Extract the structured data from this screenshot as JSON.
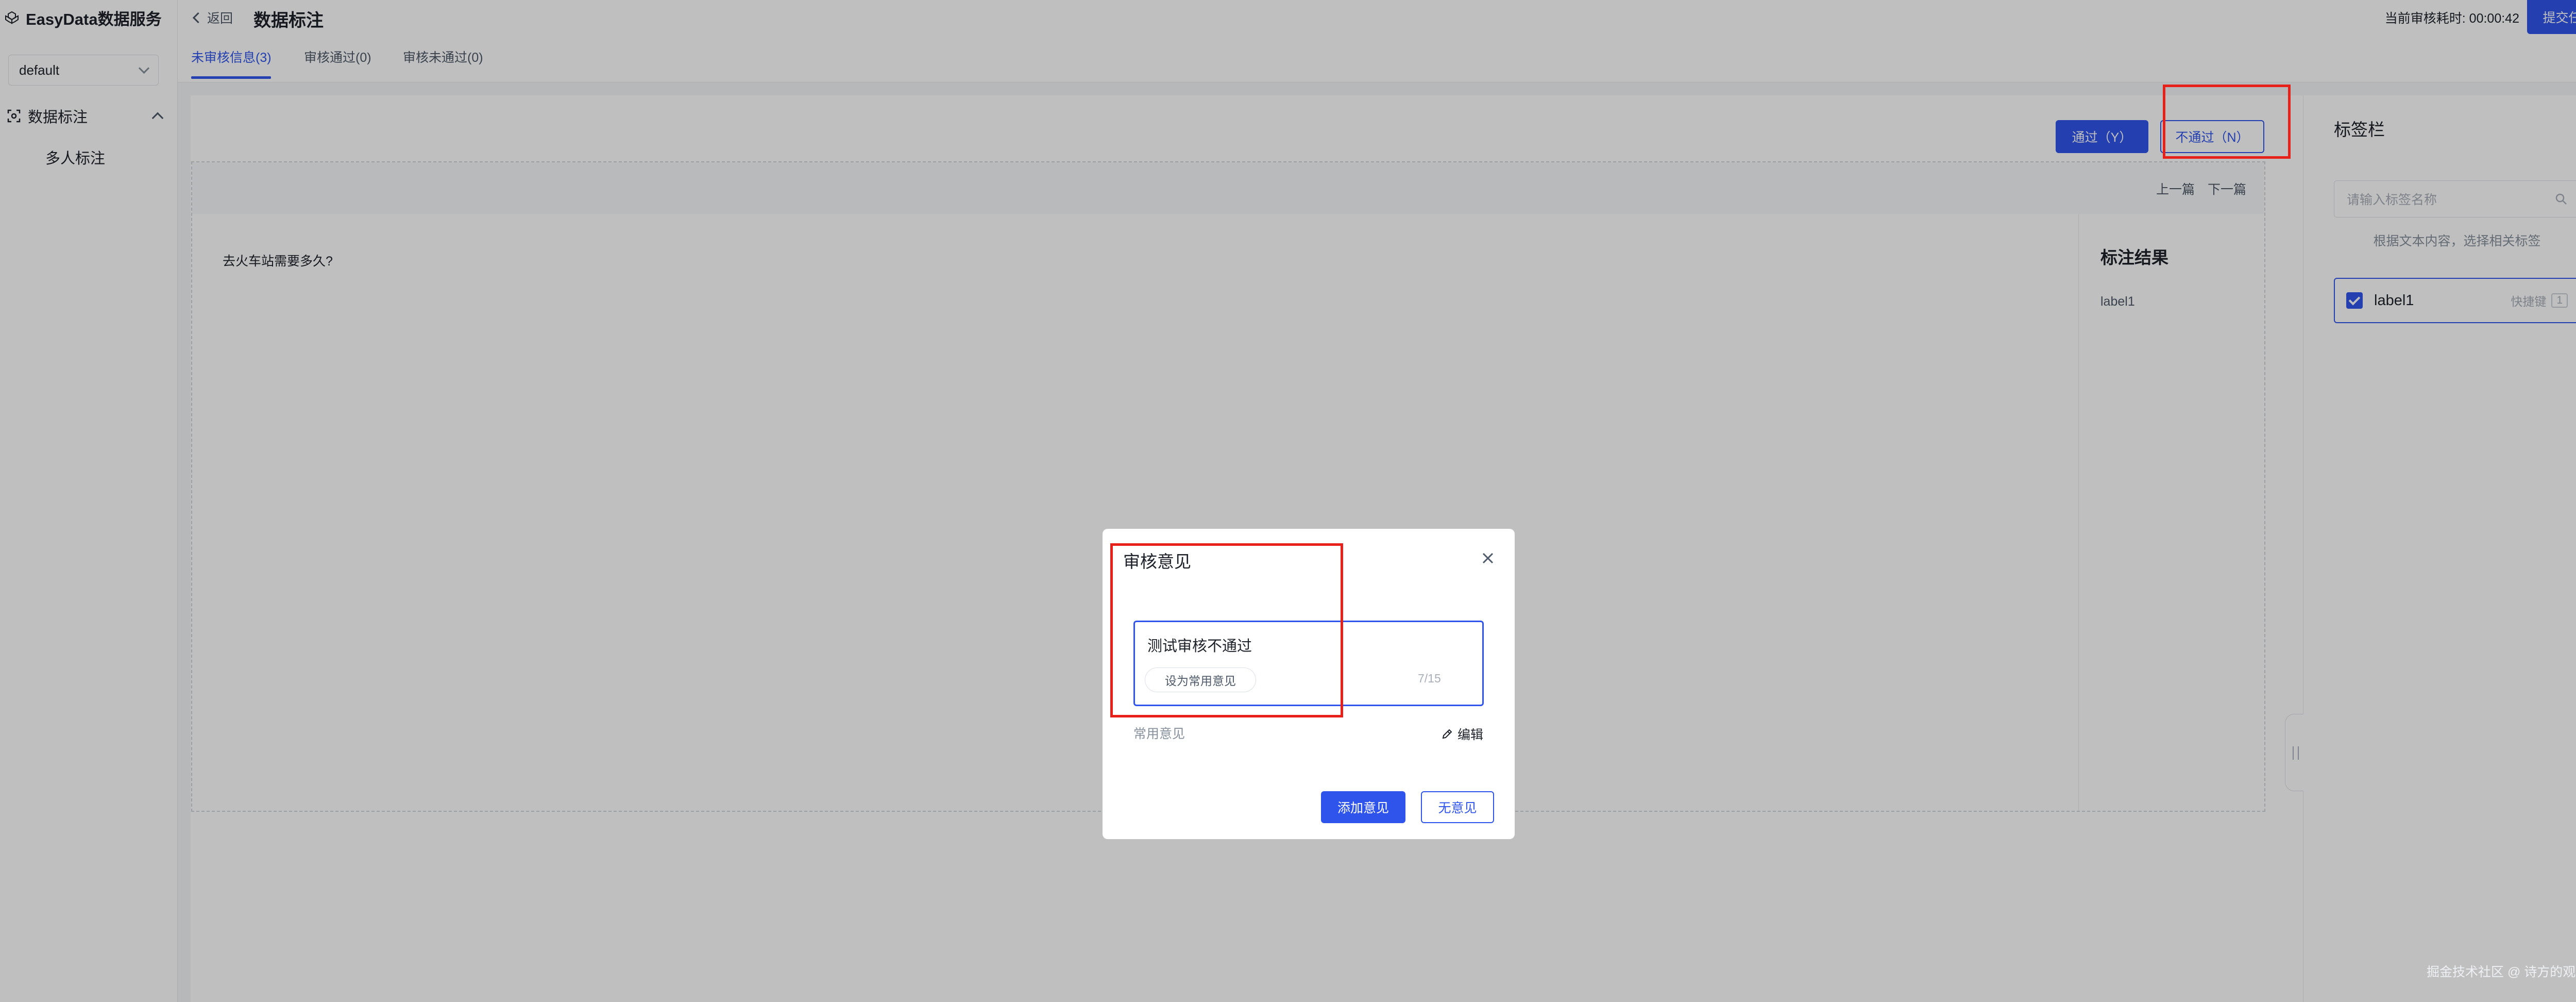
{
  "app": {
    "name": "EasyData数据服务"
  },
  "sidebar": {
    "workspace": "default",
    "group_label": "数据标注",
    "sub_item": "多人标注"
  },
  "header": {
    "back_label": "返回",
    "title": "数据标注",
    "timer": "当前审核耗时: 00:00:42",
    "submit_label": "提交任务",
    "tabs": [
      {
        "label": "未审核信息(3)",
        "active": true
      },
      {
        "label": "审核通过(0)",
        "active": false
      },
      {
        "label": "审核未通过(0)",
        "active": false
      }
    ]
  },
  "toolbar": {
    "pass_label": "通过（Y）",
    "reject_label": "不通过（N）"
  },
  "pager": {
    "prev_label": "上一篇",
    "next_label": "下一篇"
  },
  "content": {
    "text": "去火车站需要多久?"
  },
  "result": {
    "title": "标注结果",
    "label": "label1"
  },
  "tagbar": {
    "title": "标签栏",
    "search_placeholder": "请输入标签名称",
    "hint": "根据文本内容，选择相关标签",
    "items": [
      {
        "label": "label1",
        "checked": true,
        "shortcut_label": "快捷键",
        "shortcut_key": "1"
      }
    ]
  },
  "modal": {
    "title": "审核意见",
    "opinion_text": "测试审核不通过",
    "set_common_label": "设为常用意见",
    "counter": "7/15",
    "common_label": "常用意见",
    "edit_label": "编辑",
    "add_label": "添加意见",
    "none_label": "无意见"
  },
  "watermark": "掘金技术社区 @ 诗方的观念",
  "colors": {
    "primary": "#2f54eb",
    "highlight": "#e8201a",
    "overlay": "rgba(0,0,0,0.25)"
  }
}
